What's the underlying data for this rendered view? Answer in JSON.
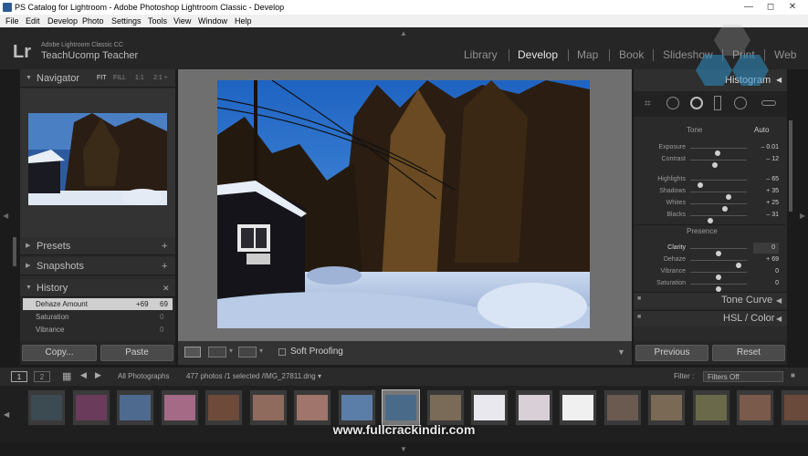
{
  "window": {
    "title": "PS Catalog for Lightroom - Adobe Photoshop Lightroom Classic - Develop",
    "min": "—",
    "max": "◻",
    "close": "✕"
  },
  "menu": [
    "File",
    "Edit",
    "Develop",
    "Photo",
    "Settings",
    "Tools",
    "View",
    "Window",
    "Help"
  ],
  "identity": {
    "logo": "Lr",
    "line1": "Adobe Lightroom Classic CC",
    "line2": "TeachUcomp Teacher"
  },
  "modules": [
    "Library",
    "Develop",
    "Map",
    "Book",
    "Slideshow",
    "Print",
    "Web"
  ],
  "active_module": "Develop",
  "left": {
    "navigator": {
      "title": "Navigator",
      "zoom": [
        "FIT",
        "FILL",
        "1:1",
        "2:1 ÷"
      ]
    },
    "presets": {
      "title": "Presets",
      "action": "+"
    },
    "snapshots": {
      "title": "Snapshots",
      "action": "+"
    },
    "history": {
      "title": "History",
      "action": "✕",
      "items": [
        {
          "name": "Dehaze Amount",
          "a": "+69",
          "b": "69"
        },
        {
          "name": "Saturation",
          "a": "",
          "b": "0"
        },
        {
          "name": "Vibrance",
          "a": "",
          "b": "0"
        }
      ]
    },
    "copy_label": "Copy...",
    "paste_label": "Paste"
  },
  "toolbar": {
    "soft_proofing": "Soft Proofing"
  },
  "right": {
    "histogram": {
      "title": "Histogram"
    },
    "tone": {
      "title": "Tone",
      "auto": "Auto",
      "sliders": [
        {
          "name": "Exposure",
          "value": "– 0.01",
          "pos": 0.48
        },
        {
          "name": "Contrast",
          "value": "– 12",
          "pos": 0.44
        },
        {
          "name": "Highlights",
          "value": "– 65",
          "pos": 0.18
        },
        {
          "name": "Shadows",
          "value": "+ 35",
          "pos": 0.68
        },
        {
          "name": "Whites",
          "value": "+ 25",
          "pos": 0.62
        },
        {
          "name": "Blacks",
          "value": "– 31",
          "pos": 0.35
        }
      ]
    },
    "presence": {
      "title": "Presence",
      "sliders": [
        {
          "name": "Clarity",
          "value": "0",
          "pos": 0.5
        },
        {
          "name": "Dehaze",
          "value": "+ 69",
          "pos": 0.85
        },
        {
          "name": "Vibrance",
          "value": "0",
          "pos": 0.5
        },
        {
          "name": "Saturation",
          "value": "0",
          "pos": 0.5
        }
      ]
    },
    "tone_curve": "Tone Curve",
    "hsl": "HSL / Color",
    "previous_label": "Previous",
    "reset_label": "Reset"
  },
  "filmstrip": {
    "page1": "1",
    "page2": "2",
    "source": "All Photographs",
    "status": "477 photos /1 selected /IMG_27811.dng ▾",
    "filter_label": "Filter :",
    "filter_value": "Filters Off",
    "thumbs": [
      {
        "color": "#3c4a52"
      },
      {
        "color": "#6a3b5a"
      },
      {
        "color": "#4e6a8f"
      },
      {
        "color": "#a46a86"
      },
      {
        "color": "#6e4a3a"
      },
      {
        "color": "#8f6b5e"
      },
      {
        "color": "#a0756b"
      },
      {
        "color": "#5b7ea8"
      },
      {
        "color": "#4a6a8a"
      },
      {
        "color": "#7a6a58"
      },
      {
        "color": "#e8e8ee"
      },
      {
        "color": "#d8d0d6"
      },
      {
        "color": "#f0f0f0"
      },
      {
        "color": "#6a5a50"
      },
      {
        "color": "#7a6a55"
      },
      {
        "color": "#6a6a4a"
      },
      {
        "color": "#7a5a4a"
      },
      {
        "color": "#6a4a3a"
      }
    ]
  },
  "watermark": "www.fullcrackindir.com"
}
